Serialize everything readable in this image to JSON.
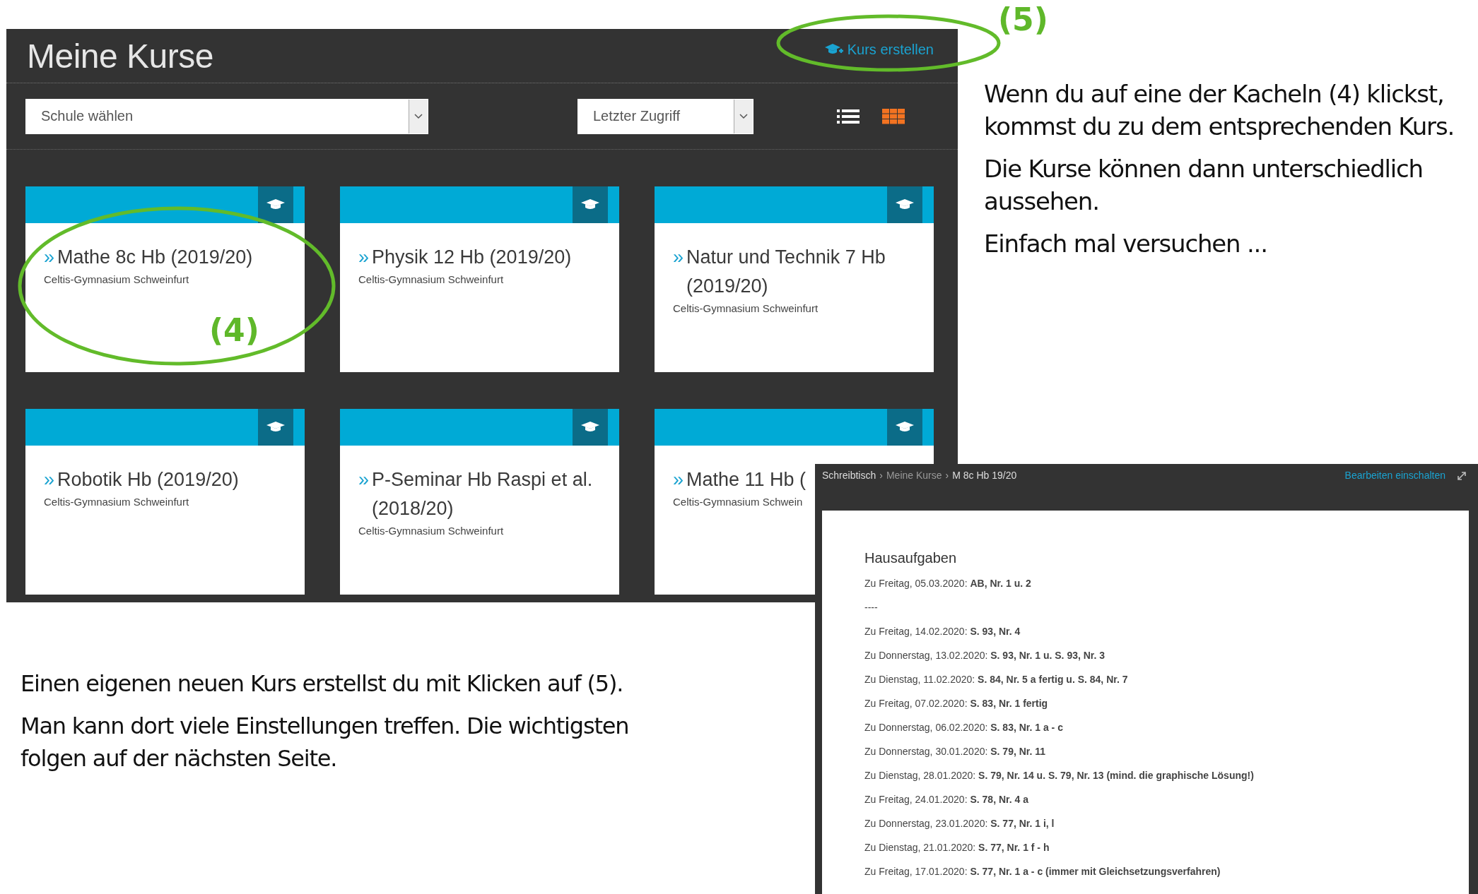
{
  "panel": {
    "title": "Meine Kurse",
    "create_button": "Kurs erstellen",
    "school_select": {
      "value": "Schule wählen"
    },
    "sort_select": {
      "value": "Letzter Zugriff"
    },
    "view_toggle": [
      {
        "kind": "list",
        "selected": false
      },
      {
        "kind": "grid",
        "selected": true
      }
    ]
  },
  "courses": [
    {
      "bullet": "»",
      "title": "Mathe 8c Hb (2019/20)",
      "school": "Celtis-Gymnasium Schweinfurt"
    },
    {
      "bullet": "»",
      "title": "Physik 12 Hb (2019/20)",
      "school": "Celtis-Gymnasium Schweinfurt"
    },
    {
      "bullet": "»",
      "title": "Natur und Technik 7 Hb (2019/20)",
      "school": "Celtis-Gymnasium Schweinfurt"
    },
    {
      "bullet": "»",
      "title": "Robotik Hb (2019/20)",
      "school": "Celtis-Gymnasium Schweinfurt"
    },
    {
      "bullet": "»",
      "title": "P-Seminar Hb Raspi et al. (2018/20)",
      "school": "Celtis-Gymnasium Schweinfurt"
    },
    {
      "bullet": "»",
      "title": "Mathe 11 Hb (",
      "school": "Celtis-Gymnasium Schwein"
    }
  ],
  "course_view": {
    "breadcrumb": [
      {
        "label": "Schreibtisch",
        "muted": false,
        "separator": "›"
      },
      {
        "label": "Meine Kurse",
        "muted": true,
        "separator": "›"
      },
      {
        "label": "M 8c Hb 19/20",
        "muted": false
      }
    ],
    "edit_link": "Bearbeiten einschalten",
    "heading": "Hausaufgaben",
    "entries": [
      "Zu Freitag, 05.03.2020: **AB, Nr. 1 u. 2**",
      "----",
      "Zu Freitag, 14.02.2020: **S. 93, Nr. 4**",
      "Zu Donnerstag, 13.02.2020: **S. 93, Nr. 1 u. S. 93, Nr. 3**",
      "Zu Dienstag, 11.02.2020: **S. 84, Nr. 5 a fertig u. S. 84, Nr. 7**",
      "Zu Freitag, 07.02.2020: **S. 83, Nr. 1 fertig**",
      "Zu Donnerstag, 06.02.2020: **S. 83, Nr. 1 a - c**",
      "Zu Donnerstag, 30.01.2020: **S. 79, Nr. 11**",
      "Zu Dienstag, 28.01.2020: **S. 79, Nr. 14 u. S. 79, Nr. 13 (mind. die graphische Lösung!)**",
      "Zu Freitag, 24.01.2020: **S. 78, Nr. 4 a**",
      "Zu Donnerstag, 23.01.2020: **S. 77, Nr. 1 i, l**",
      "Zu Dienstag, 21.01.2020: **S. 77, Nr. 1 f - h**",
      "Zu Freitag, 17.01.2020: **S. 77, Nr. 1 a - c (immer mit Gleichsetzungsverfahren)**"
    ]
  },
  "annotations": [
    {
      "label": "(4)"
    },
    {
      "label": "(5)"
    }
  ],
  "notes_right": [
    "Wenn du auf eine der Kacheln (4) klickst, kommst du zu dem entsprechenden Kurs.",
    "Die Kurse können dann unterschiedlich aussehen.",
    "Einfach mal versuchen ..."
  ],
  "notes_bottom": [
    "Einen eigenen neuen Kurs erstellst du mit Klicken auf (5).",
    "Man kann dort viele Einstellungen treffen. Die wichtigsten folgen auf der nächsten Seite."
  ]
}
